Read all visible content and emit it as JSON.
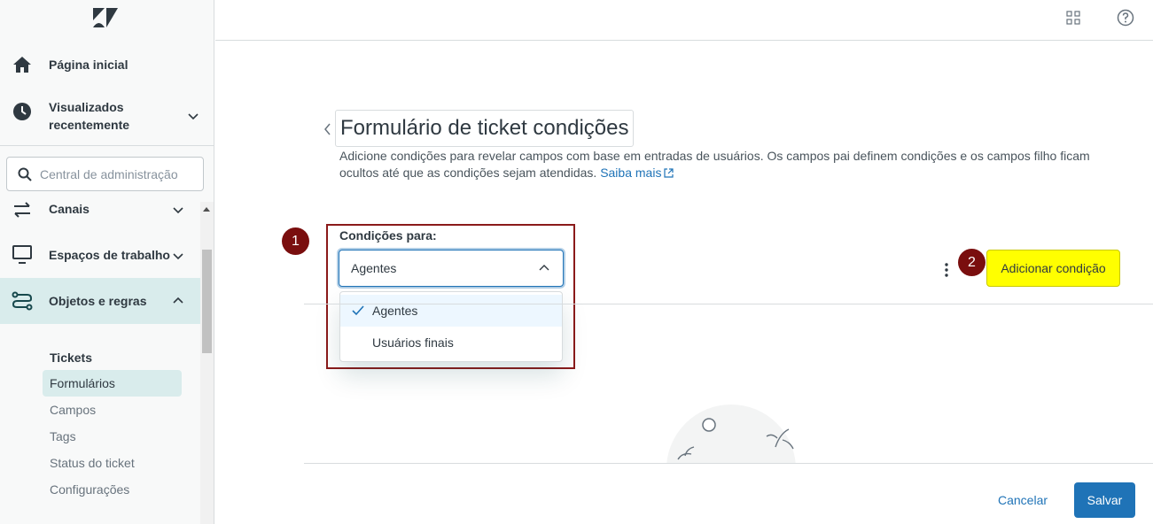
{
  "sidebar": {
    "home": "Página inicial",
    "recent_line1": "Visualizados",
    "recent_line2": "recentemente",
    "search_placeholder": "Central de administração",
    "channels": "Canais",
    "workspaces": "Espaços de trabalho",
    "objects_rules": "Objetos e regras",
    "tickets_heading": "Tickets",
    "sub_items": [
      "Formulários",
      "Campos",
      "Tags",
      "Status do ticket",
      "Configurações"
    ]
  },
  "main": {
    "title": "Formulário de ticket condições",
    "description": "Adicione condições para revelar campos com base em entradas de usuários. Os campos pai definem condições e os campos filho ficam ocultos até que as condições sejam atendidas.",
    "learn_more": "Saiba mais",
    "conditions_label": "Condições para:",
    "selected_value": "Agentes",
    "options": [
      "Agentes",
      "Usuários finais"
    ],
    "add_condition": "Adicionar condição",
    "cancel": "Cancelar",
    "save": "Salvar"
  },
  "annotations": {
    "badge1": "1",
    "badge2": "2"
  },
  "colors": {
    "accent": "#1f73b7",
    "highlight": "#ffff00",
    "annotation": "#7a0e0e",
    "active_nav": "#d9ecec"
  }
}
